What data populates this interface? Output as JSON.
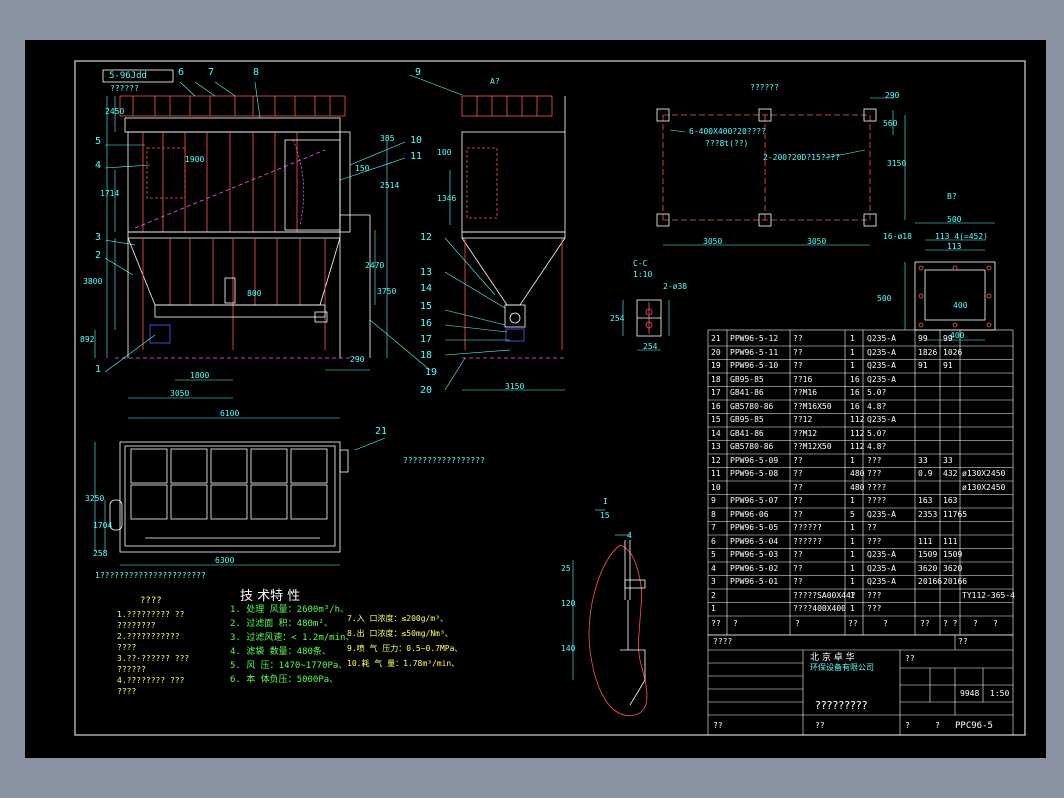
{
  "drawing": {
    "code_box": "5-96Jdd",
    "title_top": "??????",
    "plan_title": "??????",
    "view_b_title": "B?",
    "view_a_label": "A?",
    "section_cc": "C-C",
    "section_cc_scale": "1:10",
    "detail_label": "I",
    "detail_scale": "15",
    "note_plan_1": "6-400X400?20????",
    "note_plan_1b": "???8t(??)",
    "note_plan_2": "2-200?20D?15????",
    "note_21": "?????????????????",
    "note_bottom": "1??????????????????????",
    "hole_note": "16-ø18",
    "hole_note2": "2-ø38"
  },
  "part_callouts": [
    "1",
    "2",
    "3",
    "4",
    "5",
    "6",
    "7",
    "8",
    "9",
    "10",
    "11",
    "12",
    "13",
    "14",
    "15",
    "16",
    "17",
    "18",
    "19",
    "20",
    "21"
  ],
  "dims": {
    "d6100": "6100",
    "d3050": "3050",
    "d1800": "1800",
    "d290": "290",
    "d3150": "3150",
    "d6300": "6300",
    "d3250": "3250",
    "d1704": "1704",
    "d258": "258",
    "d2450": "2450",
    "d1714": "1714",
    "d3800": "3800",
    "d892": "892",
    "d2470": "2470",
    "d3750": "3750",
    "d385": "385",
    "d2514": "2514",
    "d1900": "1900",
    "d150": "150",
    "d100": "100",
    "d1346": "1346",
    "d800": "800",
    "d254": "254",
    "d500": "500",
    "d400": "400",
    "d113": "113",
    "d1134": "113 4(=452)",
    "d560": "560",
    "d140": "140",
    "d120": "120",
    "d25": "25",
    "d4": "4"
  },
  "tech_title": "技 术特 性",
  "tech_items": [
    "1. 处理 风量：2600m³/h、",
    "2. 过滤面 积：480m²、",
    "3. 过滤风速：< 1.2m/min、",
    "4. 滤袋 数量：480条、",
    "5. 风 压：1470~1770Pa、",
    "6. 本 体负压：5000Pa、"
  ],
  "tech_items2": [
    "7.入 口浓度：≤200g/m³、",
    "8.出 口浓度：≤50mg/Nm³、",
    "9.喷 气 压力：0.5~0.7MPa、",
    "10.耗 气 量：1.78m³/min、"
  ],
  "notes_title": "????",
  "notes": [
    "1.????????? ??",
    "  ????????",
    "2.???????????",
    "  ????",
    "3.??·?????? ???",
    "  ??????",
    "4.???????? ???",
    "  ????"
  ],
  "bom": [
    {
      "no": "21",
      "code": "PPW96-5-12",
      "name": "??",
      "qty": "1",
      "mat": "Q235-A",
      "w1": "99",
      "w2": "99",
      "note": ""
    },
    {
      "no": "20",
      "code": "PPW96-5-11",
      "name": "??",
      "qty": "1",
      "mat": "Q235-A",
      "w1": "1826",
      "w2": "1026",
      "note": ""
    },
    {
      "no": "19",
      "code": "PPW96-5-10",
      "name": "??",
      "qty": "1",
      "mat": "Q235-A",
      "w1": "91",
      "w2": "91",
      "note": ""
    },
    {
      "no": "18",
      "code": "GB95-85",
      "name": "??16",
      "qty": "16",
      "mat": "Q235-A",
      "w1": "",
      "w2": "",
      "note": ""
    },
    {
      "no": "17",
      "code": "GB41-86",
      "name": "??M16",
      "qty": "16",
      "mat": "5.0?",
      "w1": "",
      "w2": "",
      "note": ""
    },
    {
      "no": "16",
      "code": "GB5780-86",
      "name": "??M16X50",
      "qty": "16",
      "mat": "4.8?",
      "w1": "",
      "w2": "",
      "note": ""
    },
    {
      "no": "15",
      "code": "GB95-85",
      "name": "??12",
      "qty": "112",
      "mat": "Q235-A",
      "w1": "",
      "w2": "",
      "note": ""
    },
    {
      "no": "14",
      "code": "GB41-86",
      "name": "??M12",
      "qty": "112",
      "mat": "5.0?",
      "w1": "",
      "w2": "",
      "note": ""
    },
    {
      "no": "13",
      "code": "GB5780-86",
      "name": "??M12X50",
      "qty": "112",
      "mat": "4.8?",
      "w1": "",
      "w2": "",
      "note": ""
    },
    {
      "no": "12",
      "code": "PPW96-5-09",
      "name": "??",
      "qty": "1",
      "mat": "???",
      "w1": "33",
      "w2": "33",
      "note": ""
    },
    {
      "no": "11",
      "code": "PPW96-5-08",
      "name": "??",
      "qty": "480",
      "mat": "???",
      "w1": "0.9",
      "w2": "432",
      "note": "ø130X2450"
    },
    {
      "no": "10",
      "code": "",
      "name": "??",
      "qty": "480",
      "mat": "????",
      "w1": "",
      "w2": "",
      "note": "ø130X2450"
    },
    {
      "no": "9",
      "code": "PPW96-5-07",
      "name": "??",
      "qty": "1",
      "mat": "????",
      "w1": "163",
      "w2": "163",
      "note": ""
    },
    {
      "no": "8",
      "code": "PPW96-06",
      "name": "??",
      "qty": "5",
      "mat": "Q235-A",
      "w1": "2353",
      "w2": "11765",
      "note": ""
    },
    {
      "no": "7",
      "code": "PPW96-5-05",
      "name": "??????",
      "qty": "1",
      "mat": "??",
      "w1": "",
      "w2": "",
      "note": ""
    },
    {
      "no": "6",
      "code": "PPW96-5-04",
      "name": "??????",
      "qty": "1",
      "mat": "???",
      "w1": "111",
      "w2": "111",
      "note": ""
    },
    {
      "no": "5",
      "code": "PPW96-5-03",
      "name": "??",
      "qty": "1",
      "mat": "Q235-A",
      "w1": "1509",
      "w2": "1509",
      "note": ""
    },
    {
      "no": "4",
      "code": "PPW96-5-02",
      "name": "??",
      "qty": "1",
      "mat": "Q235-A",
      "w1": "3620",
      "w2": "3620",
      "note": ""
    },
    {
      "no": "3",
      "code": "PPW96-5-01",
      "name": "??",
      "qty": "1",
      "mat": "Q235-A",
      "w1": "20166",
      "w2": "20166",
      "note": ""
    },
    {
      "no": "2",
      "code": "",
      "name": "?????SA00X44?",
      "qty": "1",
      "mat": "???",
      "w1": "",
      "w2": "",
      "note": "TY112-365-4"
    },
    {
      "no": "1",
      "code": "",
      "name": "????400X400",
      "qty": "1",
      "mat": "???",
      "w1": "",
      "w2": "",
      "note": ""
    }
  ],
  "bom_header": [
    "??",
    "?",
    "?",
    "??",
    "?",
    "??",
    "? ?",
    "?",
    "?"
  ],
  "title_block": {
    "org": "北 京 卓 华",
    "org2": "环保设备有限公司",
    "name": "?????????",
    "drawing_no": "PPC96-5",
    "weight": "9948",
    "scale": "1:50",
    "small": "????",
    "r1": "??",
    "r2": "??",
    "r3": "??",
    "r4": "??",
    "sheet1": "?",
    "sheet2": "?"
  }
}
